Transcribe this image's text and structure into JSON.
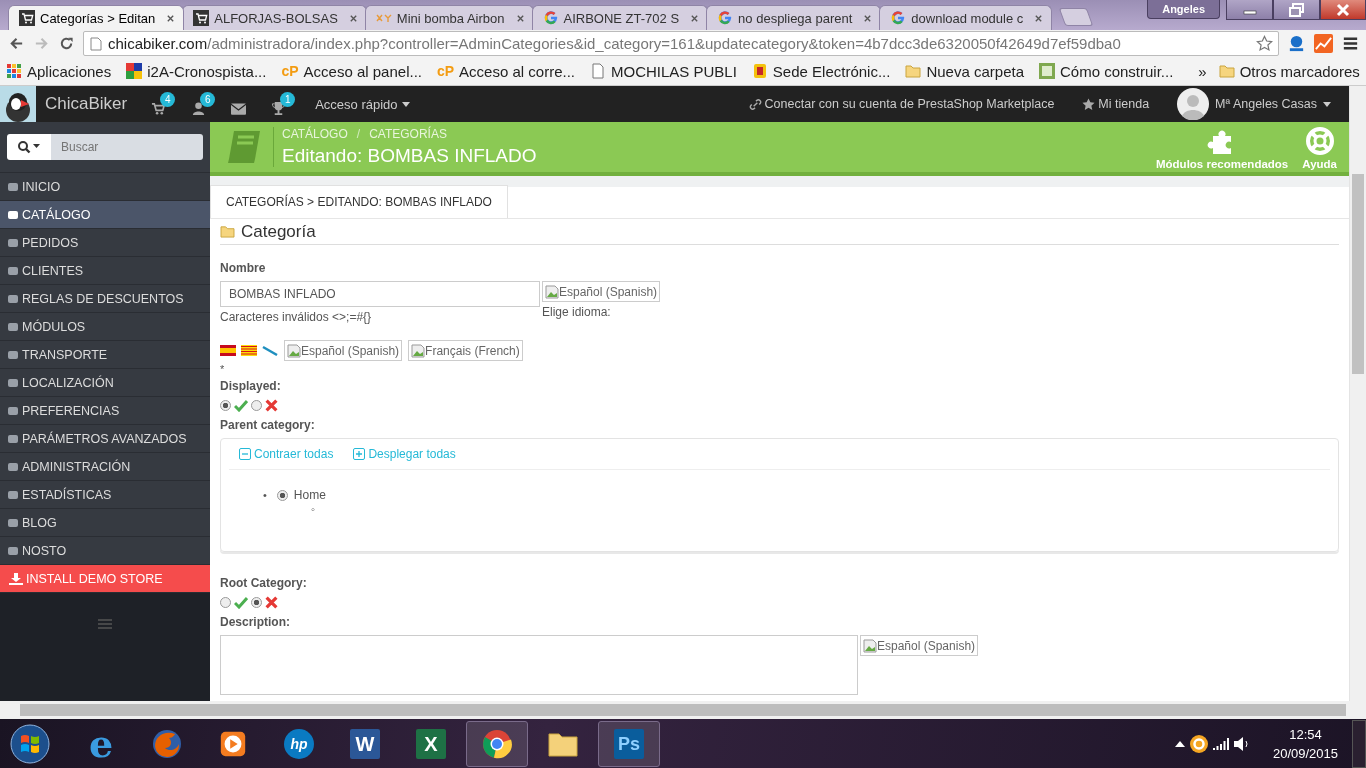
{
  "browser": {
    "tabs": [
      {
        "kind": "shop",
        "title": "Categorías > Editan",
        "selected": true
      },
      {
        "kind": "shop",
        "title": "ALFORJAS-BOLSAS",
        "selected": false
      },
      {
        "kind": "xyz",
        "title": "Mini bomba Airbon",
        "selected": false
      },
      {
        "kind": "google",
        "title": "AIRBONE ZT-702 S",
        "selected": false
      },
      {
        "kind": "google",
        "title": "no despliega parent",
        "selected": false
      },
      {
        "kind": "google",
        "title": "download module c",
        "selected": false
      }
    ],
    "profile": "Angeles",
    "url_host": "chicabiker.com",
    "url_path": "/administradora/index.php?controller=AdminCategories&id_category=161&updatecategory&token=4b7dcc3de6320050f42649d7ef59dba0",
    "bookmarks": [
      {
        "kind": "apps",
        "label": "Aplicaciones"
      },
      {
        "kind": "tiles",
        "label": "i2A-Cronospista..."
      },
      {
        "kind": "cp",
        "badge": "cP",
        "label": "Acceso al panel..."
      },
      {
        "kind": "cp",
        "badge": "cP",
        "label": "Acceso al corre..."
      },
      {
        "kind": "page",
        "label": "MOCHILAS PUBLI"
      },
      {
        "kind": "seal",
        "label": "Sede Electrónic..."
      },
      {
        "kind": "folder",
        "label": "Nueva carpeta"
      },
      {
        "kind": "wh",
        "label": "Cómo construir..."
      }
    ],
    "more": "»",
    "other_bookmarks": "Otros marcadores"
  },
  "admin_header": {
    "shop_name": "ChicaBiker",
    "notifications": [
      {
        "kind": "cart",
        "count": "4"
      },
      {
        "kind": "customer",
        "count": "6"
      },
      {
        "kind": "message"
      },
      {
        "kind": "trophy",
        "count": "1"
      }
    ],
    "quick_access": "Acceso rápido",
    "connect": "Conectar con su cuenta de PrestaShop Marketplace",
    "my_shop": "Mi tienda",
    "user": "Mª Angeles Casas"
  },
  "sidebar": {
    "search_placeholder": "Buscar",
    "items": [
      {
        "kind": "menu",
        "label": "INICIO",
        "selected": false
      },
      {
        "kind": "menu",
        "label": "CATÁLOGO",
        "selected": true
      },
      {
        "kind": "menu",
        "label": "PEDIDOS",
        "selected": false
      },
      {
        "kind": "menu",
        "label": "CLIENTES",
        "selected": false
      },
      {
        "kind": "menu",
        "label": "REGLAS DE DESCUENTOS",
        "selected": false
      },
      {
        "kind": "menu",
        "label": "MÓDULOS",
        "selected": false
      },
      {
        "kind": "menu",
        "label": "TRANSPORTE",
        "selected": false
      },
      {
        "kind": "menu",
        "label": "LOCALIZACIÓN",
        "selected": false
      },
      {
        "kind": "menu",
        "label": "PREFERENCIAS",
        "selected": false
      },
      {
        "kind": "menu",
        "label": "PARÁMETROS AVANZADOS",
        "selected": false
      },
      {
        "kind": "menu",
        "label": "ADMINISTRACIÓN",
        "selected": false
      },
      {
        "kind": "menu",
        "label": "ESTADÍSTICAS",
        "selected": false
      },
      {
        "kind": "menu",
        "label": "BLOG",
        "selected": false
      },
      {
        "kind": "menu",
        "label": "NOSTO",
        "selected": false
      },
      {
        "kind": "promo",
        "label": "INSTALL DEMO STORE",
        "selected": false
      }
    ]
  },
  "page_header": {
    "breadcrumb": [
      "CATÁLOGO",
      "CATEGORÍAS"
    ],
    "separator": "/",
    "title": "Editando: BOMBAS INFLADO",
    "actions": [
      {
        "kind": "modules",
        "label": "Módulos recomendados"
      },
      {
        "kind": "help",
        "label": "Ayuda"
      }
    ]
  },
  "page_tab": "CATEGORÍAS > EDITANDO: BOMBAS INFLADO",
  "form": {
    "legend": "Categoría",
    "name": {
      "label": "Nombre",
      "value": "BOMBAS INFLADO",
      "hint": "Caracteres inválidos <>;=#{}",
      "language_button": "Español (Spanish)",
      "language_label": "Elige idioma:"
    },
    "language_buttons": [
      "Español (Spanish)",
      "Français (French)"
    ],
    "required_mark": "*",
    "displayed": {
      "label": "Displayed:",
      "options": [
        {
          "kind": "yes",
          "selected": true
        },
        {
          "kind": "no",
          "selected": false
        }
      ]
    },
    "parent_category": {
      "label": "Parent category:",
      "links": [
        {
          "kind": "collapse",
          "label": "Contraer todas"
        },
        {
          "kind": "expand",
          "label": "Desplegar todas"
        }
      ],
      "tree": [
        {
          "bullet": "•",
          "label": "Home",
          "selected": true,
          "children": [
            {
              "bullet": "◦"
            }
          ]
        }
      ]
    },
    "root_category": {
      "label": "Root Category:",
      "options": [
        {
          "kind": "yes",
          "selected": false
        },
        {
          "kind": "no",
          "selected": true
        }
      ]
    },
    "description": {
      "label": "Description:",
      "language_button": "Español (Spanish)"
    }
  },
  "taskbar": {
    "apps": [
      {
        "kind": "ie",
        "glyph": "e",
        "running": false
      },
      {
        "kind": "firefox",
        "running": false
      },
      {
        "kind": "media",
        "running": false
      },
      {
        "kind": "hp",
        "glyph": "hp",
        "running": false
      },
      {
        "kind": "word",
        "glyph": "W",
        "running": false
      },
      {
        "kind": "excel",
        "glyph": "X",
        "running": false
      },
      {
        "kind": "chrome",
        "running": true
      },
      {
        "kind": "folder",
        "running": false
      },
      {
        "kind": "photoshop",
        "glyph": "Ps",
        "running": true
      }
    ],
    "time": "12:54",
    "date": "20/09/2015"
  }
}
